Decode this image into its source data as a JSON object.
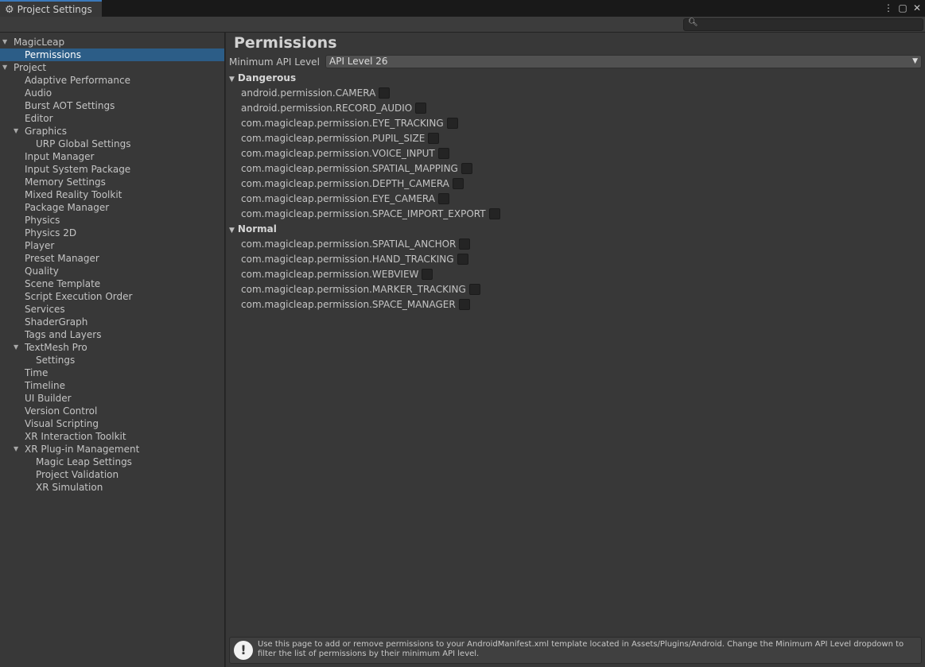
{
  "window": {
    "tab_title": "Project Settings",
    "tab_icon": "gear-icon",
    "controls": [
      "kebab-menu-icon",
      "maximize-icon",
      "close-icon"
    ]
  },
  "search": {
    "placeholder": "",
    "value": ""
  },
  "sidebar": {
    "items": [
      {
        "label": "MagicLeap",
        "depth": 0,
        "expandable": true
      },
      {
        "label": "Permissions",
        "depth": 1,
        "expandable": false,
        "selected": true
      },
      {
        "label": "Project",
        "depth": 0,
        "expandable": true
      },
      {
        "label": "Adaptive Performance",
        "depth": 1,
        "expandable": false
      },
      {
        "label": "Audio",
        "depth": 1,
        "expandable": false
      },
      {
        "label": "Burst AOT Settings",
        "depth": 1,
        "expandable": false
      },
      {
        "label": "Editor",
        "depth": 1,
        "expandable": false
      },
      {
        "label": "Graphics",
        "depth": 1,
        "expandable": true
      },
      {
        "label": "URP Global Settings",
        "depth": 2,
        "expandable": false
      },
      {
        "label": "Input Manager",
        "depth": 1,
        "expandable": false
      },
      {
        "label": "Input System Package",
        "depth": 1,
        "expandable": false
      },
      {
        "label": "Memory Settings",
        "depth": 1,
        "expandable": false
      },
      {
        "label": "Mixed Reality Toolkit",
        "depth": 1,
        "expandable": false
      },
      {
        "label": "Package Manager",
        "depth": 1,
        "expandable": false
      },
      {
        "label": "Physics",
        "depth": 1,
        "expandable": false
      },
      {
        "label": "Physics 2D",
        "depth": 1,
        "expandable": false
      },
      {
        "label": "Player",
        "depth": 1,
        "expandable": false
      },
      {
        "label": "Preset Manager",
        "depth": 1,
        "expandable": false
      },
      {
        "label": "Quality",
        "depth": 1,
        "expandable": false
      },
      {
        "label": "Scene Template",
        "depth": 1,
        "expandable": false
      },
      {
        "label": "Script Execution Order",
        "depth": 1,
        "expandable": false
      },
      {
        "label": "Services",
        "depth": 1,
        "expandable": false
      },
      {
        "label": "ShaderGraph",
        "depth": 1,
        "expandable": false
      },
      {
        "label": "Tags and Layers",
        "depth": 1,
        "expandable": false
      },
      {
        "label": "TextMesh Pro",
        "depth": 1,
        "expandable": true
      },
      {
        "label": "Settings",
        "depth": 2,
        "expandable": false
      },
      {
        "label": "Time",
        "depth": 1,
        "expandable": false
      },
      {
        "label": "Timeline",
        "depth": 1,
        "expandable": false
      },
      {
        "label": "UI Builder",
        "depth": 1,
        "expandable": false
      },
      {
        "label": "Version Control",
        "depth": 1,
        "expandable": false
      },
      {
        "label": "Visual Scripting",
        "depth": 1,
        "expandable": false
      },
      {
        "label": "XR Interaction Toolkit",
        "depth": 1,
        "expandable": false
      },
      {
        "label": "XR Plug-in Management",
        "depth": 1,
        "expandable": true
      },
      {
        "label": "Magic Leap Settings",
        "depth": 2,
        "expandable": false
      },
      {
        "label": "Project Validation",
        "depth": 2,
        "expandable": false
      },
      {
        "label": "XR Simulation",
        "depth": 2,
        "expandable": false
      }
    ]
  },
  "main": {
    "title": "Permissions",
    "api_label": "Minimum API Level",
    "api_value": "API Level 26",
    "sections": [
      {
        "name": "Dangerous",
        "permissions": [
          {
            "label": "android.permission.CAMERA",
            "checked": false
          },
          {
            "label": "android.permission.RECORD_AUDIO",
            "checked": false
          },
          {
            "label": "com.magicleap.permission.EYE_TRACKING",
            "checked": false
          },
          {
            "label": "com.magicleap.permission.PUPIL_SIZE",
            "checked": false
          },
          {
            "label": "com.magicleap.permission.VOICE_INPUT",
            "checked": false
          },
          {
            "label": "com.magicleap.permission.SPATIAL_MAPPING",
            "checked": false
          },
          {
            "label": "com.magicleap.permission.DEPTH_CAMERA",
            "checked": false
          },
          {
            "label": "com.magicleap.permission.EYE_CAMERA",
            "checked": false
          },
          {
            "label": "com.magicleap.permission.SPACE_IMPORT_EXPORT",
            "checked": false
          }
        ]
      },
      {
        "name": "Normal",
        "permissions": [
          {
            "label": "com.magicleap.permission.SPATIAL_ANCHOR",
            "checked": false
          },
          {
            "label": "com.magicleap.permission.HAND_TRACKING",
            "checked": false
          },
          {
            "label": "com.magicleap.permission.WEBVIEW",
            "checked": false
          },
          {
            "label": "com.magicleap.permission.MARKER_TRACKING",
            "checked": false
          },
          {
            "label": "com.magicleap.permission.SPACE_MANAGER",
            "checked": false
          }
        ]
      }
    ],
    "help_text": "Use this page to add or remove permissions to your AndroidManifest.xml template located in Assets/Plugins/Android. Change the Minimum API Level dropdown to filter the list of permissions by their minimum API level."
  },
  "colors": {
    "selection": "#2c5d87",
    "panel": "#383838",
    "tab_accent": "#3a79bb"
  }
}
